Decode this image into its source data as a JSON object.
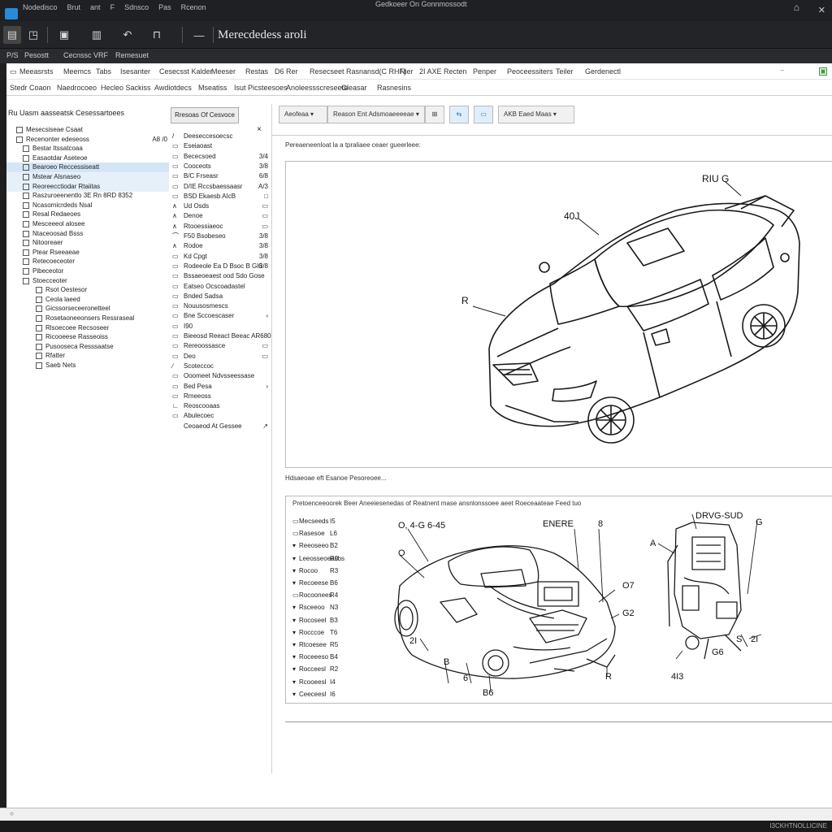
{
  "titlebar": {
    "menu": [
      "Nodedisco",
      "Brut",
      "ant",
      "F",
      "Sdnsco",
      "Pas",
      "Rcenon"
    ],
    "doc_title": "Gedkoeer On Gonnmossodt"
  },
  "toolbar": {
    "brand": "Mercedes-Benz",
    "brand_display": "Merecdedess aroli"
  },
  "menustrip": [
    "P/S",
    "Pesostt",
    "Cecnssc VRF",
    "Remesuet"
  ],
  "ribbon": {
    "row1": [
      "Meeasrsts",
      "Meemcs",
      "Tabs",
      "Isesanter",
      "Cesecsst Kalder",
      "Meeser",
      "Restas",
      "D6 Rer",
      "Resecseet Rasnansd(C RHF)",
      "Nier",
      "2I AXE Recten",
      "Penper",
      "Peoceessiters",
      "Teiler",
      "Gerdenectl"
    ],
    "row2": [
      "Stedr Coaon",
      "Naedrocoeo",
      "Hecleo Sackiss",
      "Awdiotdecs",
      "Mseatiss",
      "Isut Picsteesoes",
      "Anoleessscreseeto",
      "Gleasar",
      "Rasnesins"
    ]
  },
  "tree": {
    "header": "Ru Uasm aasseatsk Cesessartoees",
    "items": [
      {
        "label": "Mesecsiseae Csaat",
        "level": 1
      },
      {
        "label": "Recenonter edeseoss",
        "level": 1,
        "val": "A8 /0"
      },
      {
        "label": "Bestar Itssatcoaa",
        "level": 2
      },
      {
        "label": "Easaotdar Aseteoe",
        "level": 2
      },
      {
        "label": "Bearoeo Reccessiseatt",
        "level": 2,
        "sel": true
      },
      {
        "label": "Mstear Alsnaseo",
        "level": 2,
        "sel": true
      },
      {
        "label": "Reoreecctiodar Rtaiitas",
        "level": 2,
        "sel": true
      },
      {
        "label": "Raszuroeenentlo 3E Rn 8RD 8352",
        "level": 2
      },
      {
        "label": "Ncasomicrdeds Nsal",
        "level": 2
      },
      {
        "label": "Resal Redaeoes",
        "level": 2
      },
      {
        "label": "Mesceeeol alosee",
        "level": 2
      },
      {
        "label": "Ntaceoosad Bsss",
        "level": 2
      },
      {
        "label": "Nitooreaer",
        "level": 2
      },
      {
        "label": "Ptear Rseeaeae",
        "level": 2
      },
      {
        "label": "Retecoeceoter",
        "level": 2
      },
      {
        "label": "Pibeceotor",
        "level": 2
      },
      {
        "label": "Stoecceoter",
        "level": 2
      },
      {
        "label": "Rsot Oestesor",
        "level": 3
      },
      {
        "label": "Ceola laeed",
        "level": 3
      },
      {
        "label": "Gicssorseceeronetteel",
        "level": 3
      },
      {
        "label": "Rosetaoneeonsers Ressraseal",
        "level": 3
      },
      {
        "label": "Rlsoecoee Recsoseer",
        "level": 3
      },
      {
        "label": "Ricooeese Rasseoiss",
        "level": 3
      },
      {
        "label": "Pusooseca Resssaatse",
        "level": 3
      },
      {
        "label": "Rfatter",
        "level": 3
      },
      {
        "label": "Saeb Nets",
        "level": 3
      }
    ]
  },
  "midpanel": {
    "button": "Rresoas Of Cesvoce",
    "close": "×",
    "items": [
      {
        "ico": "/",
        "label": "Deeseccesoecsc",
        "val": ""
      },
      {
        "ico": "▭",
        "label": "Eseiaoast",
        "val": ""
      },
      {
        "ico": "▭",
        "label": "Bececsoed",
        "val": "3/4"
      },
      {
        "ico": "▭",
        "label": "Cooceots",
        "val": "3/8"
      },
      {
        "ico": "▭",
        "label": "B/C Frseasr",
        "val": "6/8"
      },
      {
        "ico": "▭",
        "label": "D/IE Rccsbaessaasr",
        "val": "A/3"
      },
      {
        "ico": "▭",
        "label": "BSD Ekaesb AIcB",
        "val": "□"
      },
      {
        "ico": "∧",
        "label": "Ud Osds",
        "val": "▭"
      },
      {
        "ico": "∧",
        "label": "Denoe",
        "val": "▭"
      },
      {
        "ico": "∧",
        "label": "Rtooessiaeoc",
        "val": "▭"
      },
      {
        "ico": "⌒",
        "label": "F50 Bsobeseo",
        "val": "3/8"
      },
      {
        "ico": "∧",
        "label": "Rodoe",
        "val": "3/8"
      },
      {
        "ico": "▭",
        "label": "Kd Cpgt",
        "val": "3/8"
      },
      {
        "ico": "▭",
        "label": "Rodeeole Ea D Bsoc B Gl6",
        "val": "3/8"
      },
      {
        "ico": "▭",
        "label": "Bssaeoeaest ood Sdo Gose",
        "val": ""
      },
      {
        "ico": "▭",
        "label": "Eatseo Ocscoadastel",
        "val": ""
      },
      {
        "ico": "▭",
        "label": "Bnded Sadsa",
        "val": ""
      },
      {
        "ico": "▭",
        "label": "Nouusosmescs",
        "val": ""
      },
      {
        "ico": "▭",
        "label": "Bne Sccoescaser",
        "val": "›"
      },
      {
        "ico": "▭",
        "label": "I90",
        "val": ""
      },
      {
        "ico": "▭",
        "label": "Bieeosd Reeact Beeac AR680",
        "val": ""
      },
      {
        "ico": "▭",
        "label": "Rereoossasce",
        "val": "▭"
      },
      {
        "ico": "▭",
        "label": "Deo",
        "val": "▭"
      },
      {
        "ico": "∕",
        "label": "Scoteccoc",
        "val": ""
      },
      {
        "ico": "▭",
        "label": "Ooomeet Ndvsseessase",
        "val": ""
      },
      {
        "ico": "▭",
        "label": "Bed Pesa",
        "val": "›"
      },
      {
        "ico": "▭",
        "label": "Rmeeoss",
        "val": ""
      },
      {
        "ico": "∟",
        "label": "Reoscooaas",
        "val": ""
      },
      {
        "ico": "▭",
        "label": "Abulecoec",
        "val": ""
      },
      {
        "ico": "",
        "label": "Ceoaeod At Gessee",
        "val": "↗"
      }
    ]
  },
  "right": {
    "toolbar": {
      "dropdown1": "Aeofeaa ▾",
      "dropdown2": "Reason Ent Adsmoaeeeeae ▾",
      "dropdown3": "AKB Eaed Maas ▾"
    },
    "caption1": "Pereaeneenloat la a tpraliaee ceaer gueerleee:",
    "diagram1_labels": {
      "l1": "RIU G",
      "l2": "40J",
      "l3": "R"
    },
    "caption2": "Hdsaeoae eft Esanoe Pesoreoee...",
    "diagram2_title": "Pretoenceeoorek Beer Aneeiesenedas of Reatnent mase ansnlonssoee aeet Roeceaateae Feed tuo",
    "diagram2_labels": {
      "a": "O, 4-G 6-45",
      "b": "ENERE",
      "c": "8",
      "d": "O",
      "e": "O7",
      "f": "G2",
      "g": "2I",
      "h": "B",
      "i": "6",
      "j": "R",
      "k": "B6",
      "m": "DRVG-SUD",
      "n": "G",
      "o": "A",
      "p": "G6",
      "q": "S",
      "r": "2I",
      "s": "4I3"
    },
    "legend": [
      {
        "m": "▭",
        "label": "Mecseeds",
        "val": "I5"
      },
      {
        "m": "▭",
        "label": "Rasesoe",
        "val": "L6"
      },
      {
        "m": "▾",
        "label": "Reeoseeo",
        "val": "B2"
      },
      {
        "m": "▾",
        "label": "Leeosseoeasbs",
        "val": "R0"
      },
      {
        "m": "▾",
        "label": "Rocoo",
        "val": "R3"
      },
      {
        "m": "▾",
        "label": "Recoeese",
        "val": "B6"
      },
      {
        "m": "▭",
        "label": "Rocoonees",
        "val": "R4"
      },
      {
        "m": "▾",
        "label": "Rsceeoo",
        "val": "N3"
      },
      {
        "m": "▾",
        "label": "Rocoseel",
        "val": "B3"
      },
      {
        "m": "▾",
        "label": "Rocccoe",
        "val": "T6"
      },
      {
        "m": "▾",
        "label": "Rtcoesee",
        "val": "R5"
      },
      {
        "m": "▾",
        "label": "Roceeeso",
        "val": "B4"
      },
      {
        "m": "▾",
        "label": "Rocceesl",
        "val": "R2"
      },
      {
        "m": "▾",
        "label": "Rcooeesl",
        "val": "I4"
      },
      {
        "m": "▾",
        "label": "Ceeceesl",
        "val": "I6"
      }
    ]
  },
  "statusbar": {
    "left": "○",
    "right": "I3CKHTNOLLICINE"
  },
  "colors": {
    "accent": "#2a8ad8",
    "selection": "#d4e6f5",
    "dark": "#1f2023"
  }
}
